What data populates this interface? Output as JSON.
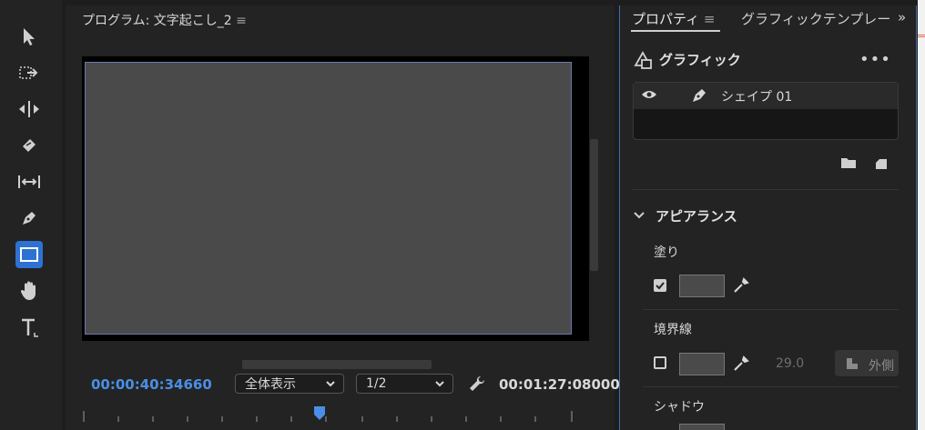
{
  "toolbar": {
    "tools": [
      {
        "name": "selection-tool",
        "icon": "arrow-icon"
      },
      {
        "name": "track-select-tool",
        "icon": "track-select-icon"
      },
      {
        "name": "ripple-edit-tool",
        "icon": "ripple-edit-icon"
      },
      {
        "name": "razor-tool",
        "icon": "razor-icon"
      },
      {
        "name": "slip-tool",
        "icon": "slip-icon"
      },
      {
        "name": "pen-tool",
        "icon": "pen-icon"
      },
      {
        "name": "rectangle-tool",
        "icon": "rectangle-icon",
        "active": true
      },
      {
        "name": "hand-tool",
        "icon": "hand-icon"
      },
      {
        "name": "type-tool",
        "icon": "type-icon"
      }
    ],
    "active_color": "#2d72d2"
  },
  "monitor": {
    "title": "プログラム: 文字起こし_2",
    "current_time": "00:00:40:34660",
    "duration": "00:01:27:08000",
    "zoom": "全体表示",
    "resolution": "1/2",
    "timecode_color": "#4a8fe7"
  },
  "properties": {
    "tab_active": "プロパティ",
    "tab_graphics": "グラフィックテンプレート",
    "more_tabs": "»",
    "section_title": "グラフィック",
    "layer_name": "シェイプ 01",
    "appearance": {
      "title": "アピアランス",
      "fill_label": "塗り",
      "fill_enabled": true,
      "fill_color": "#4a4a4a",
      "stroke_label": "境界線",
      "stroke_enabled": false,
      "stroke_color": "#4a4a4a",
      "stroke_width": "29.0",
      "stroke_position": "外側",
      "shadow_label": "シャドウ"
    }
  }
}
